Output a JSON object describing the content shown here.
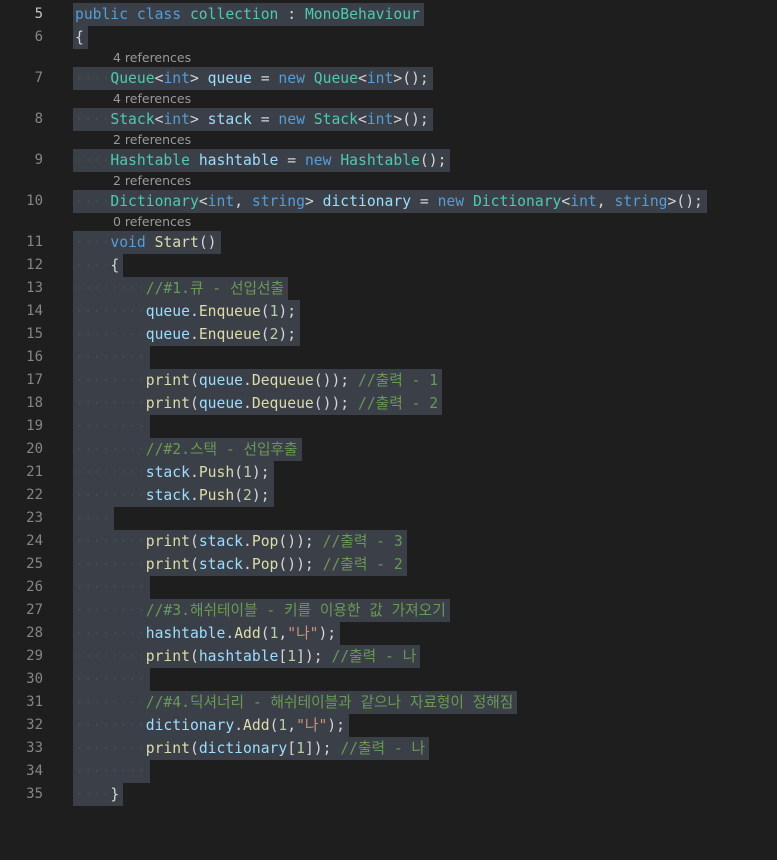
{
  "colors": {
    "background": "#1e1e1e",
    "selection": "#3b4048",
    "keyword": "#569cd6",
    "type": "#4ec9b0",
    "method": "#dcdcaa",
    "variable": "#9cdcfe",
    "number": "#b5cea8",
    "string": "#ce9178",
    "comment": "#6a9955",
    "line_number": "#858585",
    "codelens": "#999999"
  },
  "editor": {
    "lines": [
      {
        "type": "code",
        "number": "5",
        "indent": "",
        "tokens": [
          [
            "kw",
            "public"
          ],
          [
            "pn",
            " "
          ],
          [
            "kw",
            "class"
          ],
          [
            "pn",
            " "
          ],
          [
            "ty",
            "collection"
          ],
          [
            "pn",
            " : "
          ],
          [
            "ty",
            "MonoBehaviour"
          ]
        ]
      },
      {
        "type": "code",
        "number": "6",
        "indent": "",
        "tokens": [
          [
            "pn",
            "{"
          ]
        ]
      },
      {
        "type": "lens",
        "text": "4 references"
      },
      {
        "type": "code",
        "number": "7",
        "indent": "    ",
        "tokens": [
          [
            "ty",
            "Queue"
          ],
          [
            "pn",
            "<"
          ],
          [
            "kw",
            "int"
          ],
          [
            "pn",
            "> "
          ],
          [
            "vr",
            "queue"
          ],
          [
            "pn",
            " = "
          ],
          [
            "kw",
            "new"
          ],
          [
            "pn",
            " "
          ],
          [
            "ty",
            "Queue"
          ],
          [
            "pn",
            "<"
          ],
          [
            "kw",
            "int"
          ],
          [
            "pn",
            ">();"
          ]
        ]
      },
      {
        "type": "lens",
        "text": "4 references"
      },
      {
        "type": "code",
        "number": "8",
        "indent": "    ",
        "tokens": [
          [
            "ty",
            "Stack"
          ],
          [
            "pn",
            "<"
          ],
          [
            "kw",
            "int"
          ],
          [
            "pn",
            "> "
          ],
          [
            "vr",
            "stack"
          ],
          [
            "pn",
            " = "
          ],
          [
            "kw",
            "new"
          ],
          [
            "pn",
            " "
          ],
          [
            "ty",
            "Stack"
          ],
          [
            "pn",
            "<"
          ],
          [
            "kw",
            "int"
          ],
          [
            "pn",
            ">();"
          ]
        ]
      },
      {
        "type": "lens",
        "text": "2 references"
      },
      {
        "type": "code",
        "number": "9",
        "indent": "    ",
        "tokens": [
          [
            "ty",
            "Hashtable"
          ],
          [
            "pn",
            " "
          ],
          [
            "vr",
            "hashtable"
          ],
          [
            "pn",
            " = "
          ],
          [
            "kw",
            "new"
          ],
          [
            "pn",
            " "
          ],
          [
            "ty",
            "Hashtable"
          ],
          [
            "pn",
            "();"
          ]
        ]
      },
      {
        "type": "lens",
        "text": "2 references"
      },
      {
        "type": "code",
        "number": "10",
        "indent": "    ",
        "tokens": [
          [
            "ty",
            "Dictionary"
          ],
          [
            "pn",
            "<"
          ],
          [
            "kw",
            "int"
          ],
          [
            "pn",
            ", "
          ],
          [
            "kw",
            "string"
          ],
          [
            "pn",
            "> "
          ],
          [
            "vr",
            "dictionary"
          ],
          [
            "pn",
            " = "
          ],
          [
            "kw",
            "new"
          ],
          [
            "pn",
            " "
          ],
          [
            "ty",
            "Dictionary"
          ],
          [
            "pn",
            "<"
          ],
          [
            "kw",
            "int"
          ],
          [
            "pn",
            ", "
          ],
          [
            "kw",
            "string"
          ],
          [
            "pn",
            ">();"
          ]
        ]
      },
      {
        "type": "lens",
        "text": "0 references"
      },
      {
        "type": "code",
        "number": "11",
        "indent": "    ",
        "tokens": [
          [
            "kw",
            "void"
          ],
          [
            "pn",
            " "
          ],
          [
            "fn",
            "Start"
          ],
          [
            "pn",
            "()"
          ]
        ]
      },
      {
        "type": "code",
        "number": "12",
        "indent": "    ",
        "tokens": [
          [
            "pn",
            "{"
          ]
        ]
      },
      {
        "type": "code",
        "number": "13",
        "indent": "        ",
        "tokens": [
          [
            "cm",
            "//#1.큐 - 선입선출"
          ]
        ]
      },
      {
        "type": "code",
        "number": "14",
        "indent": "        ",
        "tokens": [
          [
            "vr",
            "queue"
          ],
          [
            "pn",
            "."
          ],
          [
            "fn",
            "Enqueue"
          ],
          [
            "pn",
            "("
          ],
          [
            "nm",
            "1"
          ],
          [
            "pn",
            ");"
          ]
        ]
      },
      {
        "type": "code",
        "number": "15",
        "indent": "        ",
        "tokens": [
          [
            "vr",
            "queue"
          ],
          [
            "pn",
            "."
          ],
          [
            "fn",
            "Enqueue"
          ],
          [
            "pn",
            "("
          ],
          [
            "nm",
            "2"
          ],
          [
            "pn",
            ");"
          ]
        ]
      },
      {
        "type": "code",
        "number": "16",
        "indent": "        ",
        "tokens": []
      },
      {
        "type": "code",
        "number": "17",
        "indent": "        ",
        "tokens": [
          [
            "fn",
            "print"
          ],
          [
            "pn",
            "("
          ],
          [
            "vr",
            "queue"
          ],
          [
            "pn",
            "."
          ],
          [
            "fn",
            "Dequeue"
          ],
          [
            "pn",
            "()); "
          ],
          [
            "cm",
            "//출력 - 1"
          ]
        ]
      },
      {
        "type": "code",
        "number": "18",
        "indent": "        ",
        "tokens": [
          [
            "fn",
            "print"
          ],
          [
            "pn",
            "("
          ],
          [
            "vr",
            "queue"
          ],
          [
            "pn",
            "."
          ],
          [
            "fn",
            "Dequeue"
          ],
          [
            "pn",
            "()); "
          ],
          [
            "cm",
            "//출력 - 2"
          ]
        ]
      },
      {
        "type": "code",
        "number": "19",
        "indent": "        ",
        "tokens": []
      },
      {
        "type": "code",
        "number": "20",
        "indent": "        ",
        "tokens": [
          [
            "cm",
            "//#2.스택 - 선입후출"
          ]
        ]
      },
      {
        "type": "code",
        "number": "21",
        "indent": "        ",
        "tokens": [
          [
            "vr",
            "stack"
          ],
          [
            "pn",
            "."
          ],
          [
            "fn",
            "Push"
          ],
          [
            "pn",
            "("
          ],
          [
            "nm",
            "1"
          ],
          [
            "pn",
            ");"
          ]
        ]
      },
      {
        "type": "code",
        "number": "22",
        "indent": "        ",
        "tokens": [
          [
            "vr",
            "stack"
          ],
          [
            "pn",
            "."
          ],
          [
            "fn",
            "Push"
          ],
          [
            "pn",
            "("
          ],
          [
            "nm",
            "2"
          ],
          [
            "pn",
            ");"
          ]
        ]
      },
      {
        "type": "code",
        "number": "23",
        "indent": "    ",
        "tokens": []
      },
      {
        "type": "code",
        "number": "24",
        "indent": "        ",
        "tokens": [
          [
            "fn",
            "print"
          ],
          [
            "pn",
            "("
          ],
          [
            "vr",
            "stack"
          ],
          [
            "pn",
            "."
          ],
          [
            "fn",
            "Pop"
          ],
          [
            "pn",
            "()); "
          ],
          [
            "cm",
            "//출력 - 3"
          ]
        ]
      },
      {
        "type": "code",
        "number": "25",
        "indent": "        ",
        "tokens": [
          [
            "fn",
            "print"
          ],
          [
            "pn",
            "("
          ],
          [
            "vr",
            "stack"
          ],
          [
            "pn",
            "."
          ],
          [
            "fn",
            "Pop"
          ],
          [
            "pn",
            "()); "
          ],
          [
            "cm",
            "//출력 - 2"
          ]
        ]
      },
      {
        "type": "code",
        "number": "26",
        "indent": "        ",
        "tokens": []
      },
      {
        "type": "code",
        "number": "27",
        "indent": "        ",
        "tokens": [
          [
            "cm",
            "//#3.해쉬테이블 - 키를 이용한 값 가져오기"
          ]
        ]
      },
      {
        "type": "code",
        "number": "28",
        "indent": "        ",
        "tokens": [
          [
            "vr",
            "hashtable"
          ],
          [
            "pn",
            "."
          ],
          [
            "fn",
            "Add"
          ],
          [
            "pn",
            "("
          ],
          [
            "nm",
            "1"
          ],
          [
            "pn",
            ","
          ],
          [
            "st",
            "\"나\""
          ],
          [
            "pn",
            ");"
          ]
        ]
      },
      {
        "type": "code",
        "number": "29",
        "indent": "        ",
        "tokens": [
          [
            "fn",
            "print"
          ],
          [
            "pn",
            "("
          ],
          [
            "vr",
            "hashtable"
          ],
          [
            "pn",
            "["
          ],
          [
            "nm",
            "1"
          ],
          [
            "pn",
            "]); "
          ],
          [
            "cm",
            "//출력 - 나"
          ]
        ]
      },
      {
        "type": "code",
        "number": "30",
        "indent": "        ",
        "tokens": []
      },
      {
        "type": "code",
        "number": "31",
        "indent": "        ",
        "tokens": [
          [
            "cm",
            "//#4.딕셔너리 - 해쉬테이블과 같으나 자료형이 정해짐"
          ]
        ]
      },
      {
        "type": "code",
        "number": "32",
        "indent": "        ",
        "tokens": [
          [
            "vr",
            "dictionary"
          ],
          [
            "pn",
            "."
          ],
          [
            "fn",
            "Add"
          ],
          [
            "pn",
            "("
          ],
          [
            "nm",
            "1"
          ],
          [
            "pn",
            ","
          ],
          [
            "st",
            "\"나\""
          ],
          [
            "pn",
            ");"
          ]
        ]
      },
      {
        "type": "code",
        "number": "33",
        "indent": "        ",
        "tokens": [
          [
            "fn",
            "print"
          ],
          [
            "pn",
            "("
          ],
          [
            "vr",
            "dictionary"
          ],
          [
            "pn",
            "["
          ],
          [
            "nm",
            "1"
          ],
          [
            "pn",
            "]); "
          ],
          [
            "cm",
            "//출력 - 나"
          ]
        ]
      },
      {
        "type": "code",
        "number": "34",
        "indent": "        ",
        "tokens": []
      },
      {
        "type": "code",
        "number": "35",
        "indent": "    ",
        "tokens": [
          [
            "pn",
            "}"
          ]
        ]
      }
    ]
  }
}
